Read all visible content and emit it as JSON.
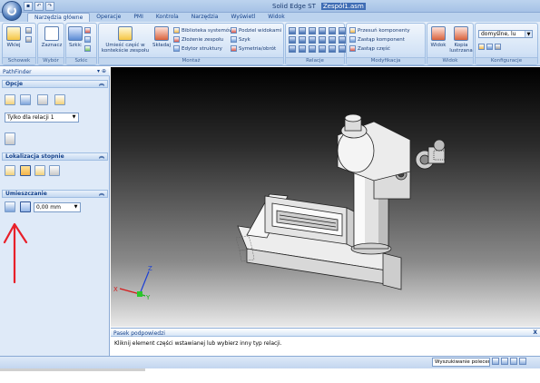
{
  "app": {
    "title": "Solid Edge ST",
    "document": "Zespół1.asm"
  },
  "quick_access": {
    "items": [
      "save-icon",
      "undo-icon",
      "redo-icon"
    ]
  },
  "tabs": [
    {
      "label": "Narzędzia główne",
      "active": true
    },
    {
      "label": "Operacje"
    },
    {
      "label": "PMI"
    },
    {
      "label": "Kontrola"
    },
    {
      "label": "Narzędzia"
    },
    {
      "label": "Wyświetl"
    },
    {
      "label": "Widok"
    }
  ],
  "ribbon": {
    "groups": {
      "schowek": "Schowek",
      "wybor": "Wybór",
      "szkic": "Szkic",
      "montaz": "Montaż",
      "relacje": "Relacje",
      "modyfikacja": "Modyfikacja",
      "widok": "Widok",
      "konfiguracje": "Konfiguracje"
    },
    "buttons": {
      "wklej": "Wklej",
      "zaznacz": "Zaznacz",
      "szkic": "Szkic",
      "umiesc_czesc_line1": "Umieść część w",
      "umiesc_czesc_line2": "kontekście zespołu",
      "skladaj": "Składaj",
      "biblioteka": "Biblioteka systemów",
      "otworz_zespol": "Złożenie zespołu",
      "edytor_struktury": "Edytor struktury",
      "podziel": "Podziel widokami",
      "szyk": "Szyk",
      "symetria": "Symetria/obrót",
      "przesun": "Przesuń komponenty",
      "zastap": "Zastąp komponent",
      "zastap_czesc": "Zastąp część",
      "widok": "Widok",
      "kopia_lustrzana_line1": "Kopia",
      "kopia_lustrzana_line2": "lustrzana"
    },
    "config_value": "domyślne, lu"
  },
  "pathfinder": {
    "title": "PathFinder",
    "opcje": "Opcje",
    "relation_type": "Tylko dla relacji 1",
    "lokalizacja": "Lokalizacja stopnie",
    "umieszczanie": "Umieszczanie",
    "offset_value": "0,00 mm"
  },
  "prompt": {
    "title": "Pasek podpowiedzi",
    "close": "X",
    "message": "Kliknij element części wstawianej lub wybierz inny typ relacji."
  },
  "status": {
    "search_placeholder": "Wyszukiwanie poleceń"
  },
  "colors": {
    "ribbon": "#c9dcf2",
    "viewport_top": "#000000",
    "viewport_bottom": "#e9e9e9",
    "annotation_arrow": "#e8202a"
  },
  "viewport": {
    "triad_labels": [
      "Z",
      "X",
      "Y"
    ]
  }
}
